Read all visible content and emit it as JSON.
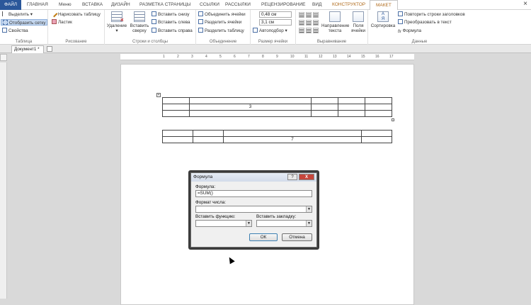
{
  "ribbon_tabs": [
    "ФАЙЛ",
    "ГЛАВНАЯ",
    "Меню",
    "ВСТАВКА",
    "ДИЗАЙН",
    "РАЗМЕТКА СТРАНИЦЫ",
    "ССЫЛКИ",
    "РАССЫЛКИ",
    "РЕЦЕНЗИРОВАНИЕ",
    "ВИД",
    "КОНСТРУКТОР",
    "МАКЕТ"
  ],
  "groups": {
    "table": {
      "label": "Таблица",
      "items": [
        "Выделить",
        "Отобразить сетку",
        "Свойства"
      ]
    },
    "draw": {
      "label": "Рисование",
      "items": [
        "Нарисовать таблицу",
        "Ластик"
      ]
    },
    "rows_cols": {
      "label": "Строки и столбцы",
      "delete": "Удаление",
      "insert_above": "Вставить сверху",
      "items": [
        "Вставить снизу",
        "Вставить слева",
        "Вставить справа"
      ]
    },
    "merge": {
      "label": "Объединение",
      "items": [
        "Объединить ячейки",
        "Разделить ячейки",
        "Разделить таблицу"
      ]
    },
    "cell_size": {
      "label": "Размер ячейки",
      "height": "0,48 см",
      "width": "3,1 см",
      "autofit": "Автоподбор"
    },
    "align": {
      "label": "Выравнивание",
      "direction": "Направление текста",
      "margins": "Поля ячейки"
    },
    "data": {
      "label": "Данные",
      "sort": "Сортировка",
      "items": [
        "Повторить строки заголовков",
        "Преобразовать в текст",
        "Формула"
      ]
    }
  },
  "close_glyph": "×",
  "doc_tab": "Документ1 *",
  "ruler_numbers": [
    "1",
    "2",
    "3",
    "4",
    "5",
    "6",
    "7",
    "8",
    "9",
    "10",
    "11",
    "12",
    "13",
    "14",
    "15",
    "16",
    "17"
  ],
  "table1": {
    "value": "3"
  },
  "table2": {
    "value": "7"
  },
  "dialog": {
    "title": "Формула",
    "help": "?",
    "close": "X",
    "formula_label": "Формула:",
    "formula_value": "=SUM()",
    "format_label": "Формат числа:",
    "func_label": "Вставить функцию:",
    "bookmark_label": "Вставить закладку:",
    "ok": "ОК",
    "cancel": "Отмена"
  }
}
